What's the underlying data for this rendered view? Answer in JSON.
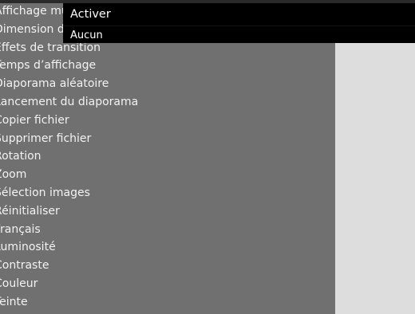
{
  "menu": {
    "items": [
      {
        "label": "Affichage multiple"
      },
      {
        "label": "Dimension d'image"
      },
      {
        "label": "Effets de transition"
      },
      {
        "label": "Temps d’affichage"
      },
      {
        "label": "Diaporama aléatoire"
      },
      {
        "label": "Lancement du diaporama"
      },
      {
        "label": "Copier fichier"
      },
      {
        "label": "Supprimer fichier"
      },
      {
        "label": "Rotation"
      },
      {
        "label": "Zoom"
      },
      {
        "label": "Sélection images"
      },
      {
        "label": "Réinitialiser"
      },
      {
        "label": "Français"
      },
      {
        "label": "Luminosité"
      },
      {
        "label": "Contraste"
      },
      {
        "label": "Couleur"
      },
      {
        "label": "Teinte"
      }
    ]
  },
  "submenu": {
    "activer_label": "Activer",
    "aucun_label": "Aucun"
  },
  "colors": {
    "menu_background": "#707070",
    "submenu_background": "#000000",
    "right_area": "#dddddd"
  }
}
